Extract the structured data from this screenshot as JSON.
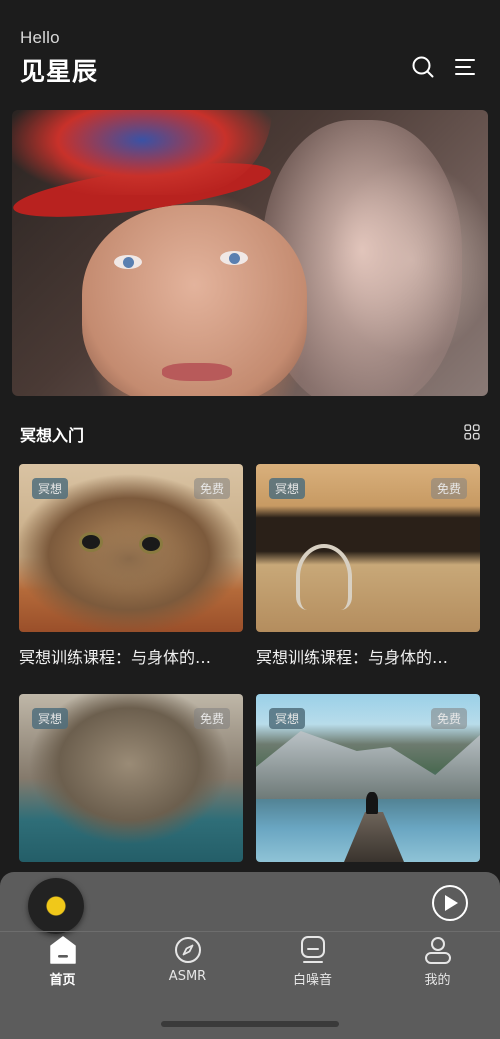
{
  "header": {
    "greeting": "Hello",
    "title": "见星辰"
  },
  "icons": {
    "search": "search-icon",
    "menu": "menu-lines-icon",
    "grid": "grid-icon"
  },
  "section": {
    "title": "冥想入门"
  },
  "cards": [
    {
      "tag": "冥想",
      "badge": "免费",
      "title": "冥想训练课程：与身体的…"
    },
    {
      "tag": "冥想",
      "badge": "免费",
      "title": "冥想训练课程：与身体的…"
    },
    {
      "tag": "冥想",
      "badge": "免费",
      "title": ""
    },
    {
      "tag": "冥想",
      "badge": "免费",
      "title": ""
    }
  ],
  "tabs": [
    {
      "label": "首页",
      "icon": "home-icon",
      "active": true
    },
    {
      "label": "ASMR",
      "icon": "compass-icon",
      "active": false
    },
    {
      "label": "白噪音",
      "icon": "radio-icon",
      "active": false
    },
    {
      "label": "我的",
      "icon": "user-icon",
      "active": false
    }
  ],
  "colors": {
    "background": "#1c1c1c",
    "player": "#5c5c5c",
    "tag": "#506e7d",
    "disc_center": "#f0c81a"
  }
}
